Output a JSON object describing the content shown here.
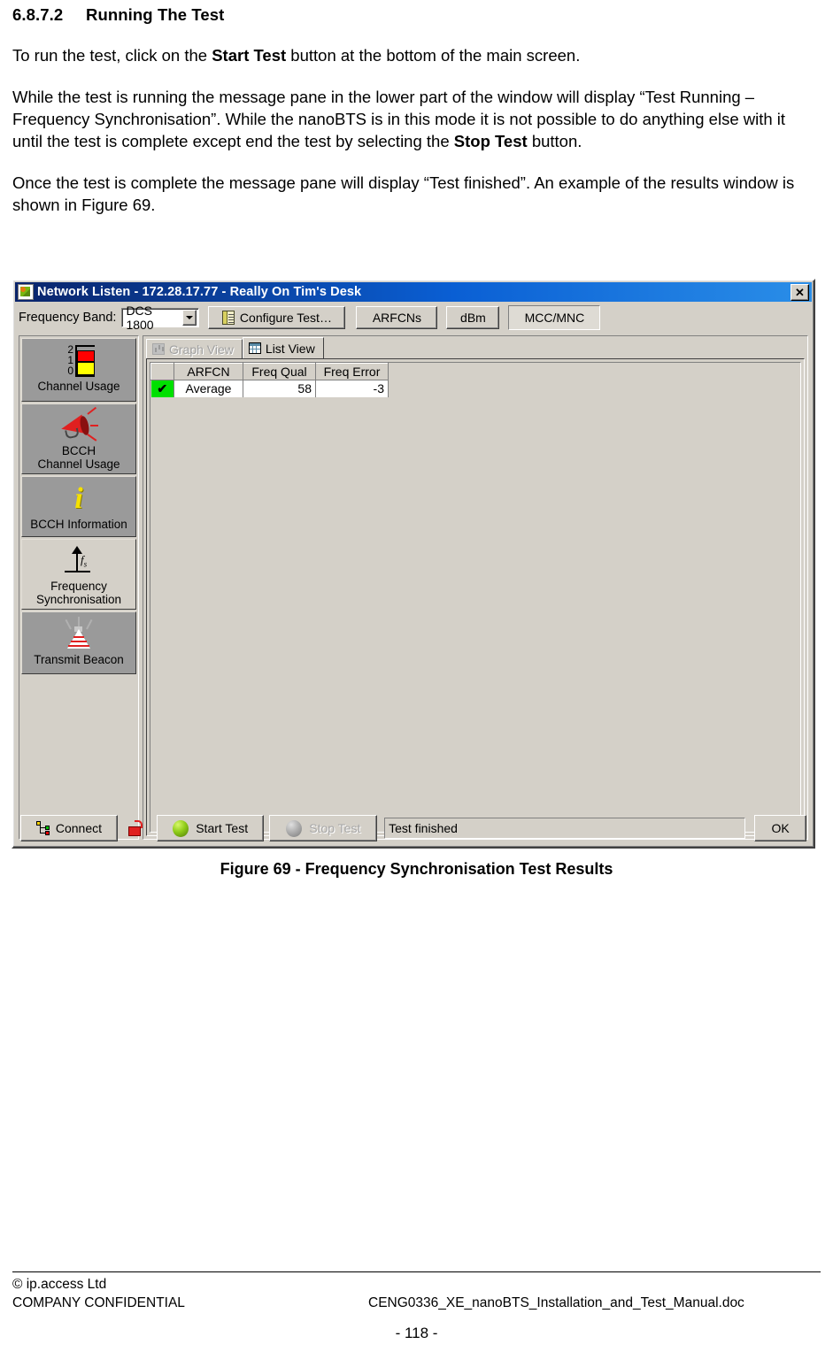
{
  "document": {
    "heading_number": "6.8.7.2",
    "heading_text": "Running The Test",
    "paragraphs": [
      {
        "parts": [
          {
            "text": "To run the test, click on the ",
            "bold": false
          },
          {
            "text": "Start Test",
            "bold": true
          },
          {
            "text": " button at the bottom of the main screen.",
            "bold": false
          }
        ]
      },
      {
        "parts": [
          {
            "text": "While the test is running the message pane in the lower part of the window will display “Test Running – Frequency Synchronisation”. While the nanoBTS is in this mode it is not possible to do anything else with it until the test is complete except end the test by selecting the ",
            "bold": false
          },
          {
            "text": "Stop Test",
            "bold": true
          },
          {
            "text": " button.",
            "bold": false
          }
        ]
      },
      {
        "parts": [
          {
            "text": "Once the test is complete the message pane will display “Test finished”. An example of the results window is shown in Figure 69.",
            "bold": false
          }
        ]
      }
    ],
    "figure_caption": "Figure 69 -  Frequency Synchronisation Test Results",
    "footer": {
      "copyright": "© ip.access Ltd",
      "confidentiality": "COMPANY CONFIDENTIAL",
      "filename": "CENG0336_XE_nanoBTS_Installation_and_Test_Manual.doc",
      "page_number": "- 118 -"
    }
  },
  "window": {
    "title": "Network Listen - 172.28.17.77 - Really On Tim's Desk",
    "close_label": "✕",
    "app_icon": "puzzle-piece-icon"
  },
  "toolbar": {
    "frequency_band_label": "Frequency Band:",
    "frequency_band_value": "DCS 1800",
    "frequency_band_options": [
      "DCS 1800"
    ],
    "configure_test_label": "Configure Test…",
    "arfcns_label": "ARFCNs",
    "dbm_label": "dBm",
    "mcc_mnc_label": "MCC/MNC",
    "mcc_mnc_pressed": true
  },
  "sidebar": {
    "items": [
      {
        "id": "channel-usage",
        "label": "Channel Usage",
        "icon": "bar-chart-icon",
        "selected": false,
        "axis_labels": [
          "2",
          "1",
          "0"
        ]
      },
      {
        "id": "bcch-channel-usage",
        "label": "BCCH\nChannel Usage",
        "icon": "megaphone-icon",
        "selected": false
      },
      {
        "id": "bcch-information",
        "label": "BCCH Information",
        "icon": "info-i-icon",
        "selected": false,
        "glyph": "i"
      },
      {
        "id": "frequency-sync",
        "label": "Frequency\nSynchronisation",
        "icon": "up-arrow-fs-icon",
        "selected": true,
        "glyph": "f"
      },
      {
        "id": "transmit-beacon",
        "label": "Transmit Beacon",
        "icon": "beacon-icon",
        "selected": false
      }
    ]
  },
  "tabs": [
    {
      "id": "graph-view",
      "label": "Graph View",
      "icon": "bar-chart-icon",
      "active": false,
      "disabled": true
    },
    {
      "id": "list-view",
      "label": "List View",
      "icon": "grid-table-icon",
      "active": true,
      "disabled": false
    }
  ],
  "results_table": {
    "columns": [
      "",
      "ARFCN",
      "Freq Qual",
      "Freq Error"
    ],
    "rows": [
      {
        "checked": true,
        "check_glyph": "✔",
        "arfcn": "Average",
        "freq_qual": "58",
        "freq_error": "-3"
      }
    ]
  },
  "bottom_bar": {
    "connect_label": "Connect",
    "connect_icon": "network-tree-icon",
    "lock_icon": "open-padlock-icon",
    "start_test_label": "Start Test",
    "start_test_enabled": true,
    "stop_test_label": "Stop Test",
    "stop_test_enabled": false,
    "status_message": "Test finished",
    "ok_label": "OK"
  },
  "colors": {
    "titlebar_start": "#0a246a",
    "titlebar_end": "#2a8ee8",
    "window_face": "#d4d0c8",
    "sidebar_item": "#9a9a9a",
    "check_cell": "#00e000",
    "bar_red": "#ff0000",
    "bar_yellow": "#ffff00",
    "led_green": "#8fcc18",
    "lock_red": "#e02020",
    "info_yellow": "#f5e000"
  }
}
